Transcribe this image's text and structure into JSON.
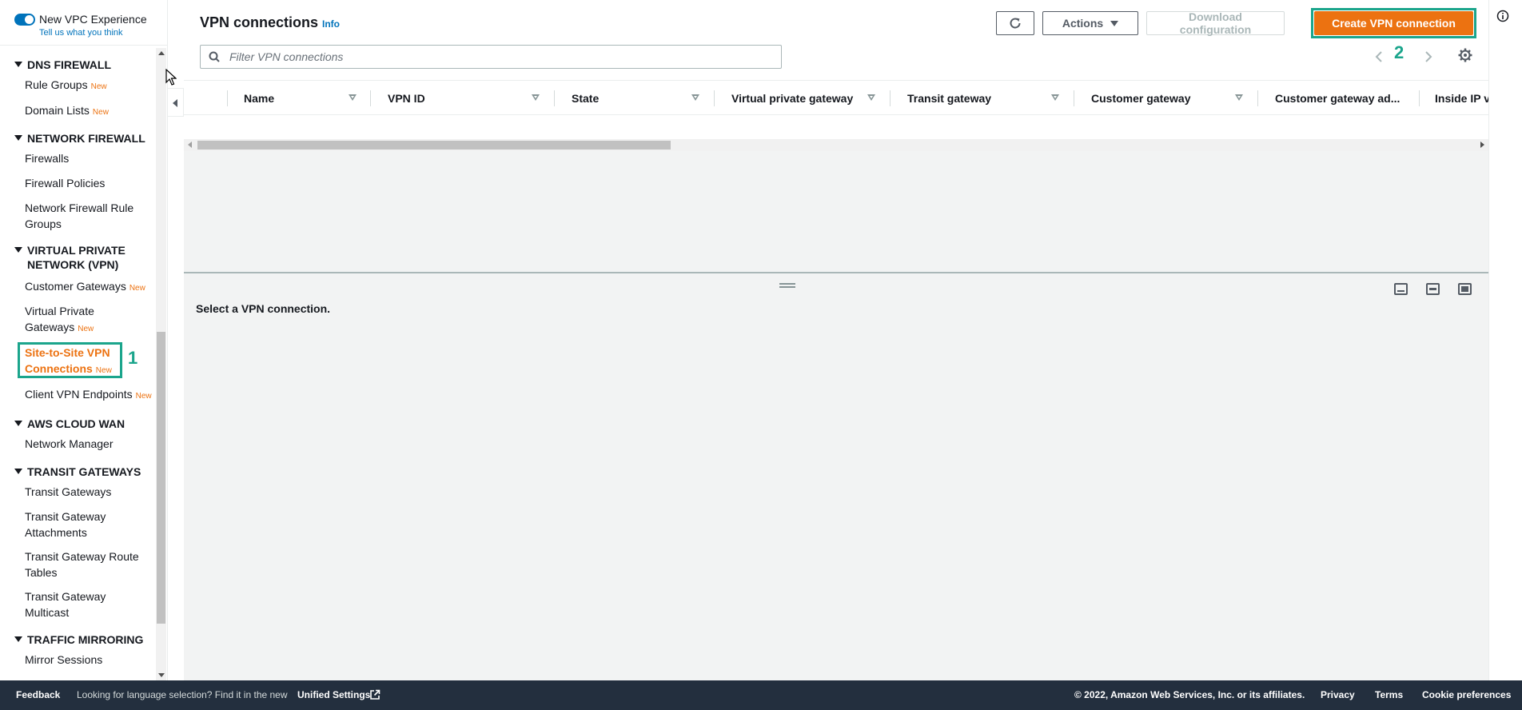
{
  "sidebar": {
    "toggle_label": "New VPC Experience",
    "feedback_link": "Tell us what you think",
    "new_badge": "New",
    "sections": {
      "dns_firewall": "DNS FIREWALL",
      "network_firewall": "NETWORK FIREWALL",
      "vpn": "VIRTUAL PRIVATE NETWORK (VPN)",
      "cloud_wan": "AWS CLOUD WAN",
      "transit_gateways": "TRANSIT GATEWAYS",
      "traffic_mirroring": "TRAFFIC MIRRORING"
    },
    "items": {
      "rule_groups": "Rule Groups",
      "domain_lists": "Domain Lists",
      "firewalls": "Firewalls",
      "firewall_policies": "Firewall Policies",
      "nf_rule_groups": "Network Firewall Rule Groups",
      "customer_gateways": "Customer Gateways",
      "virtual_private_gateways": "Virtual Private Gateways",
      "site_to_site": "Site-to-Site VPN Connections",
      "client_vpn": "Client VPN Endpoints",
      "network_manager": "Network Manager",
      "transit_gateways": "Transit Gateways",
      "tgw_attachments": "Transit Gateway Attachments",
      "tgw_route_tables": "Transit Gateway Route Tables",
      "tgw_multicast": "Transit Gateway Multicast",
      "mirror_sessions": "Mirror Sessions"
    },
    "annotation": "1"
  },
  "main": {
    "title": "VPN connections",
    "info": "Info",
    "actions_label": "Actions",
    "download_label": "Download configuration",
    "create_label": "Create VPN connection",
    "create_annotation": "2",
    "search_placeholder": "Filter VPN connections",
    "columns": [
      "Name",
      "VPN ID",
      "State",
      "Virtual private gateway",
      "Transit gateway",
      "Customer gateway",
      "Customer gateway ad...",
      "Inside IP v"
    ],
    "detail_empty": "Select a VPN connection."
  },
  "footer": {
    "feedback": "Feedback",
    "language_text": "Looking for language selection? Find it in the new",
    "unified_settings": "Unified Settings",
    "copyright": "© 2022, Amazon Web Services, Inc. or its affiliates.",
    "privacy": "Privacy",
    "terms": "Terms",
    "cookie": "Cookie preferences"
  },
  "colors": {
    "accent": "#ec7211",
    "link": "#0073bb",
    "annotation": "#1ba58c",
    "footer_bg": "#232f3e"
  },
  "icons": [
    "refresh-icon",
    "caret-down-icon",
    "search-icon",
    "chevron-left-icon",
    "chevron-right-icon",
    "gear-icon",
    "info-icon",
    "external-link-icon"
  ]
}
